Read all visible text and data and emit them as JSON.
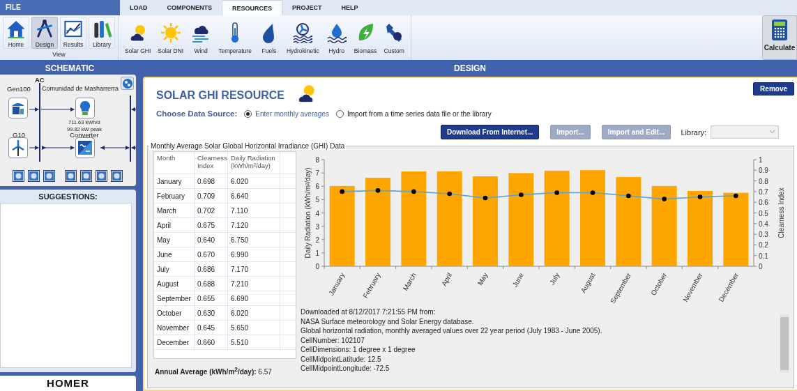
{
  "menu": {
    "file": "FILE",
    "tabs": [
      {
        "label": "LOAD",
        "selected": false
      },
      {
        "label": "COMPONENTS",
        "selected": false
      },
      {
        "label": "RESOURCES",
        "selected": true
      },
      {
        "label": "PROJECT",
        "selected": false
      },
      {
        "label": "HELP",
        "selected": false
      }
    ]
  },
  "ribbon": {
    "view_buttons": [
      {
        "label": "Home",
        "selected": false
      },
      {
        "label": "Design",
        "selected": true
      },
      {
        "label": "Results",
        "selected": false
      },
      {
        "label": "Library",
        "selected": false
      }
    ],
    "view_group": "View",
    "resource_buttons": [
      "Solar GHI",
      "Solar DNI",
      "Wind",
      "Temperature",
      "Fuels",
      "Hydrokinetic",
      "Hydro",
      "Biomass",
      "Custom"
    ],
    "calculate": "Calculate"
  },
  "schematic": {
    "title": "SCHEMATIC",
    "bus": "AC",
    "generator": "Gen100",
    "load": {
      "name": "Comunidad de Masharrerra",
      "energy": "711.63 kWh/d",
      "peak": "99.82 kW peak"
    },
    "wind": "G10",
    "converter": "Converter"
  },
  "suggestions": {
    "title": "SUGGESTIONS:"
  },
  "logo": "HOMER",
  "design": {
    "title": "DESIGN",
    "heading": "SOLAR GHI RESOURCE",
    "remove": "Remove",
    "source_label": "Choose Data Source:",
    "sources": [
      {
        "label": "Enter monthly averages",
        "selected": true
      },
      {
        "label": "Import from a time series data file or the library",
        "selected": false
      }
    ],
    "buttons": [
      {
        "label": "Download From Internet...",
        "disabled": false
      },
      {
        "label": "Import...",
        "disabled": true
      },
      {
        "label": "Import and Edit...",
        "disabled": true
      }
    ],
    "library_label": "Library:",
    "library": {
      "disabled": true
    },
    "group_title": "Monthly Average Solar Global Horizontal Irradiance (GHI) Data",
    "table": {
      "columns": [
        "Month",
        "Clearness Index",
        "Daily Radiation (kWh/m²/day)"
      ],
      "rows": [
        [
          "January",
          "0.698",
          "6.020"
        ],
        [
          "February",
          "0.709",
          "6.640"
        ],
        [
          "March",
          "0.702",
          "7.110"
        ],
        [
          "April",
          "0.675",
          "7.120"
        ],
        [
          "May",
          "0.640",
          "6.750"
        ],
        [
          "June",
          "0.670",
          "6.990"
        ],
        [
          "July",
          "0.686",
          "7.170"
        ],
        [
          "August",
          "0.688",
          "7.210"
        ],
        [
          "September",
          "0.655",
          "6.690"
        ],
        [
          "October",
          "0.630",
          "6.020"
        ],
        [
          "November",
          "0.645",
          "5.650"
        ],
        [
          "December",
          "0.660",
          "5.510"
        ]
      ]
    },
    "annual_average": "**Annual Average (kWh/m$^{2}$/day):** 6.57",
    "chart_data": {
      "type": "bar",
      "ylabel": "Daily Radiation (kWh/m²/day)",
      "y2label": "Clearness Index",
      "categories": [
        "January",
        "February",
        "March",
        "April",
        "May",
        "June",
        "July",
        "August",
        "September",
        "October",
        "November",
        "December"
      ],
      "series": [
        {
          "type": "bar",
          "color": "#ffa500",
          "values": [
            6.02,
            6.64,
            7.11,
            7.12,
            6.75,
            6.99,
            7.17,
            7.21,
            6.69,
            6.02,
            5.65,
            5.51
          ]
        },
        {
          "type": "line",
          "axis": "y2",
          "marker": "circle",
          "color": "#5aa5d6",
          "values": [
            0.7,
            0.71,
            0.7,
            0.68,
            0.64,
            0.67,
            0.69,
            0.69,
            0.66,
            0.63,
            0.65,
            0.66
          ]
        }
      ],
      "ylim": [
        0,
        8
      ],
      "yticks": [
        0,
        1,
        2,
        3,
        4,
        5,
        6,
        7,
        8
      ],
      "y2lim": [
        0,
        1
      ],
      "y2ticks": [
        0,
        0.1,
        0.2,
        0.3,
        0.4,
        0.5,
        0.6,
        0.7,
        0.8,
        0.9,
        1
      ]
    },
    "notes": [
      "Downloaded at 8/12/2017 7:21:55 PM from:",
      "NASA Surface meteorology and Solar Energy database.",
      "Global horizontal radiation, monthly averaged values over 22 year period (July 1983 - June 2005).",
      "CellNumber: 102107",
      "CellDimensions: 1 degree x 1 degree",
      "CellMidpointLatitude: 12.5",
      "CellMidpointLongitude: -72.5"
    ]
  }
}
